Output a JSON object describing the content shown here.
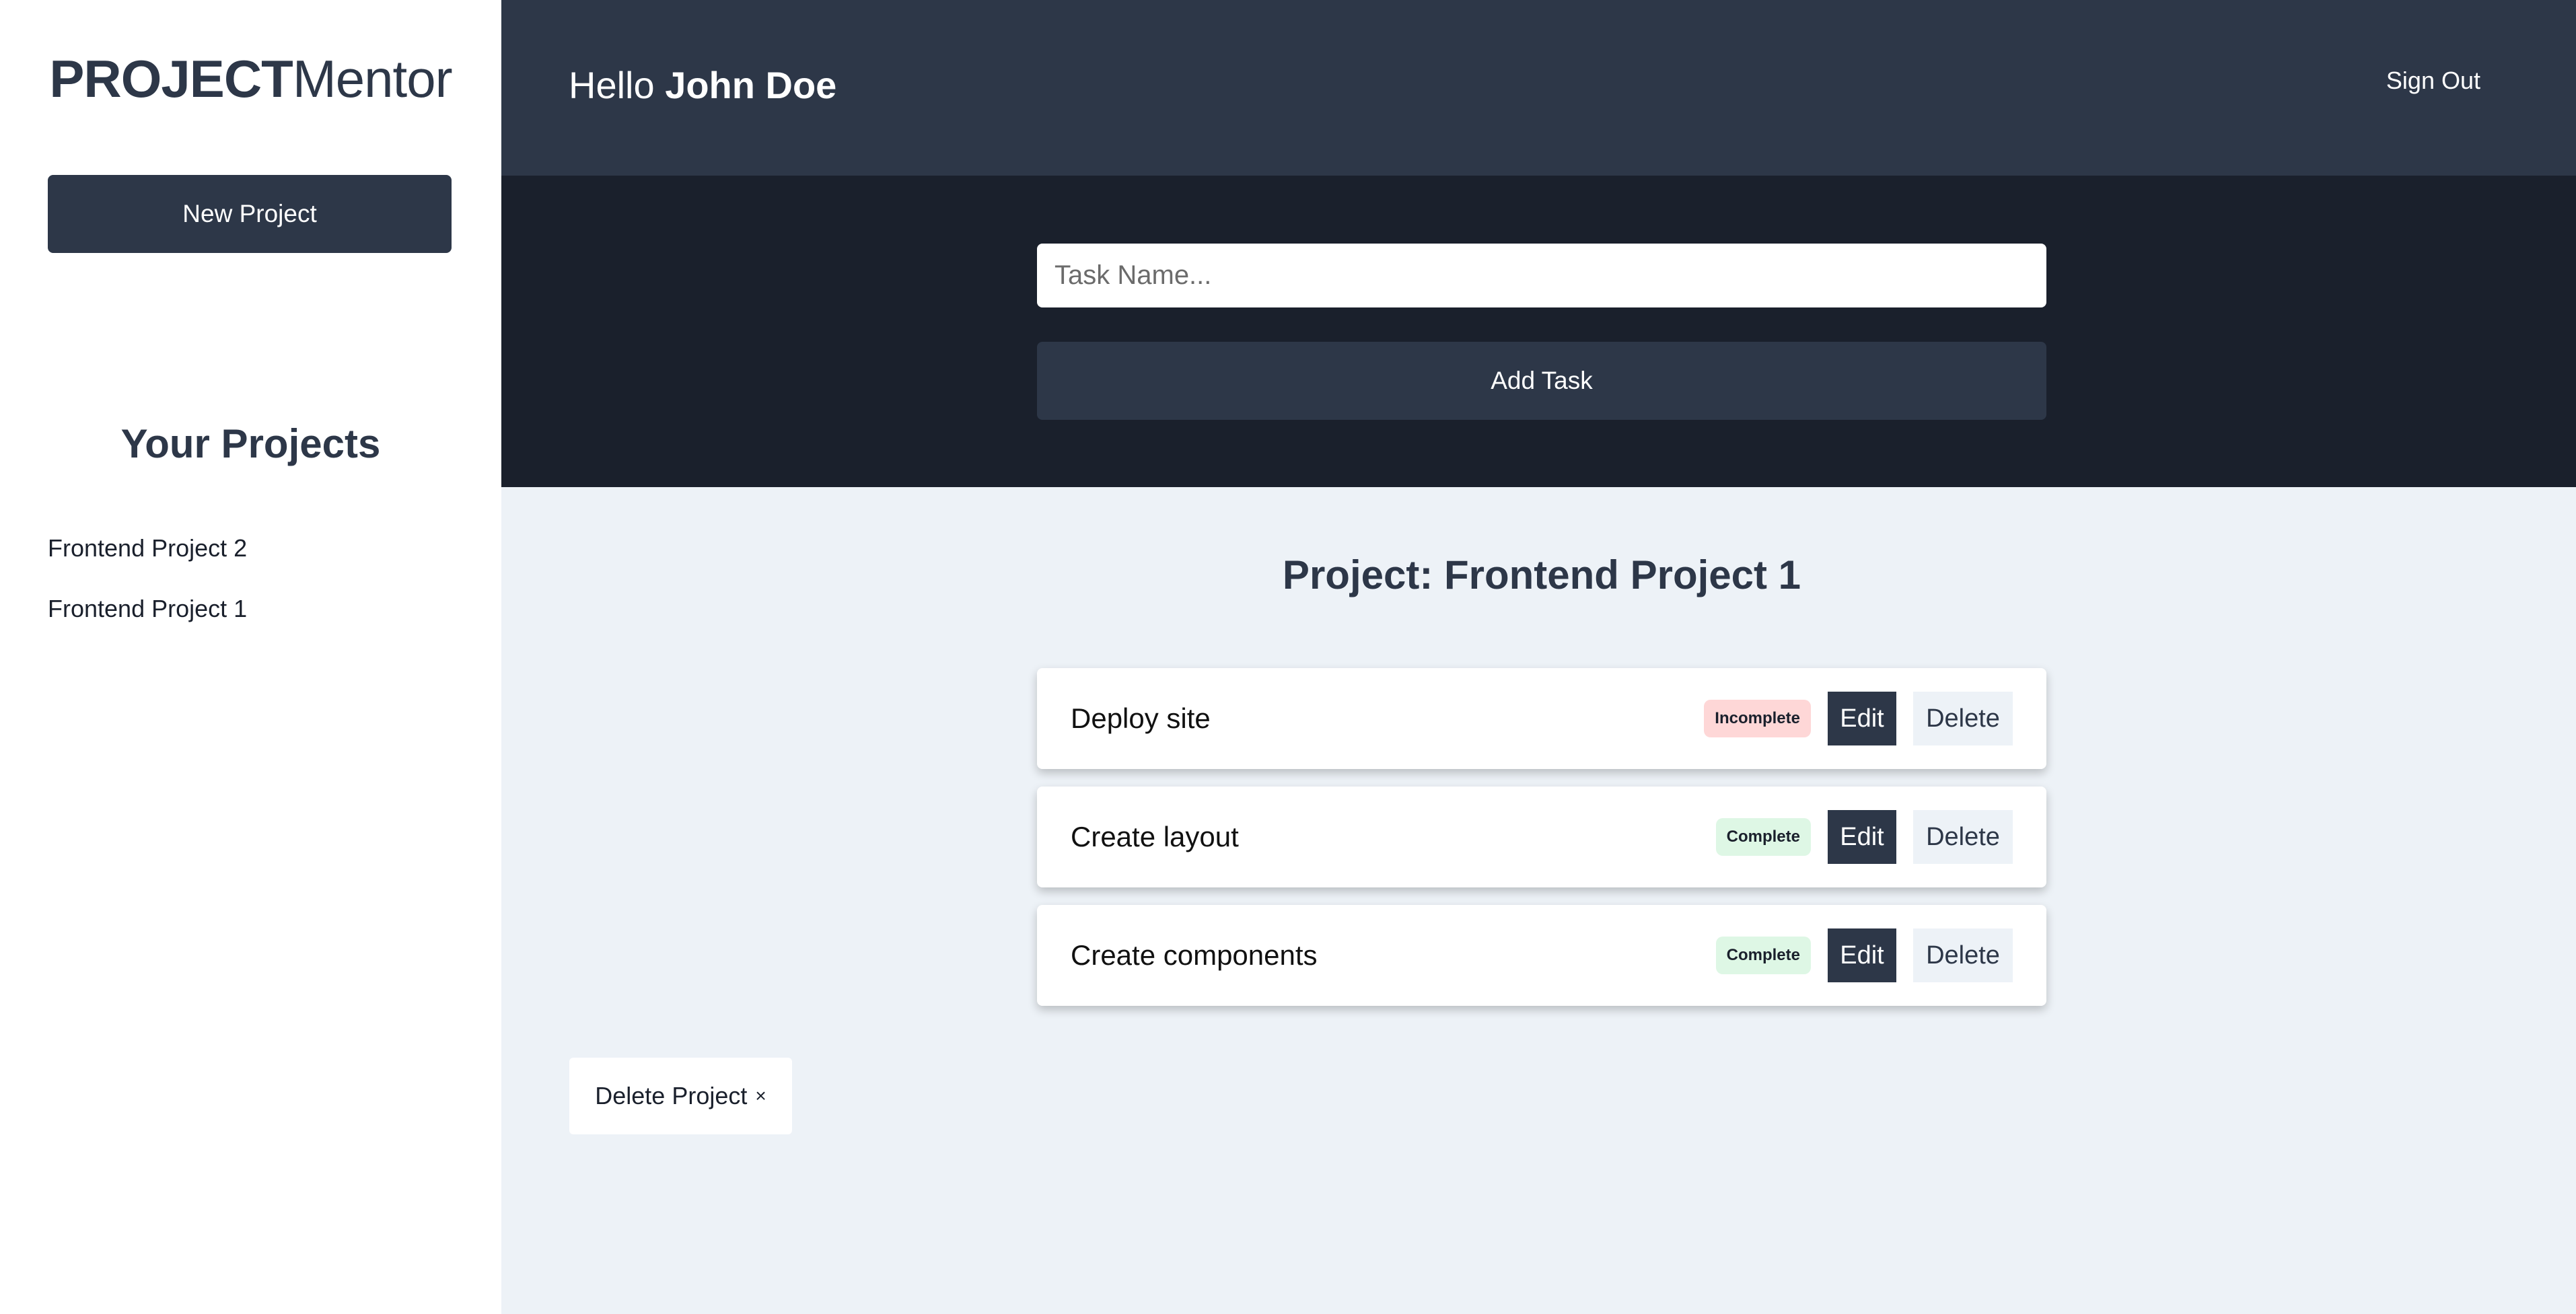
{
  "sidebar": {
    "logo_strong": "PROJECT",
    "logo_light": "Mentor",
    "new_project_label": "New Project",
    "your_projects_heading": "Your Projects",
    "projects": [
      {
        "label": "Frontend Project 2"
      },
      {
        "label": "Frontend Project 1"
      }
    ]
  },
  "header": {
    "greeting_prefix": "Hello",
    "user_name": "John Doe",
    "sign_out_label": "Sign Out"
  },
  "task_form": {
    "placeholder": "Task Name...",
    "add_task_label": "Add Task"
  },
  "main": {
    "project_title": "Project: Frontend Project 1",
    "tasks": [
      {
        "name": "Deploy site",
        "status": "Incomplete",
        "edit_label": "Edit",
        "delete_label": "Delete"
      },
      {
        "name": "Create layout",
        "status": "Complete",
        "edit_label": "Edit",
        "delete_label": "Delete"
      },
      {
        "name": "Create components",
        "status": "Complete",
        "edit_label": "Edit",
        "delete_label": "Delete"
      }
    ],
    "delete_project_label": "Delete Project",
    "delete_project_icon": "×"
  },
  "colors": {
    "primary": "#2d3748",
    "dark": "#1a202c",
    "background": "#edf2f7",
    "incomplete_badge": "#fed7d7",
    "complete_badge": "#def7e5"
  }
}
